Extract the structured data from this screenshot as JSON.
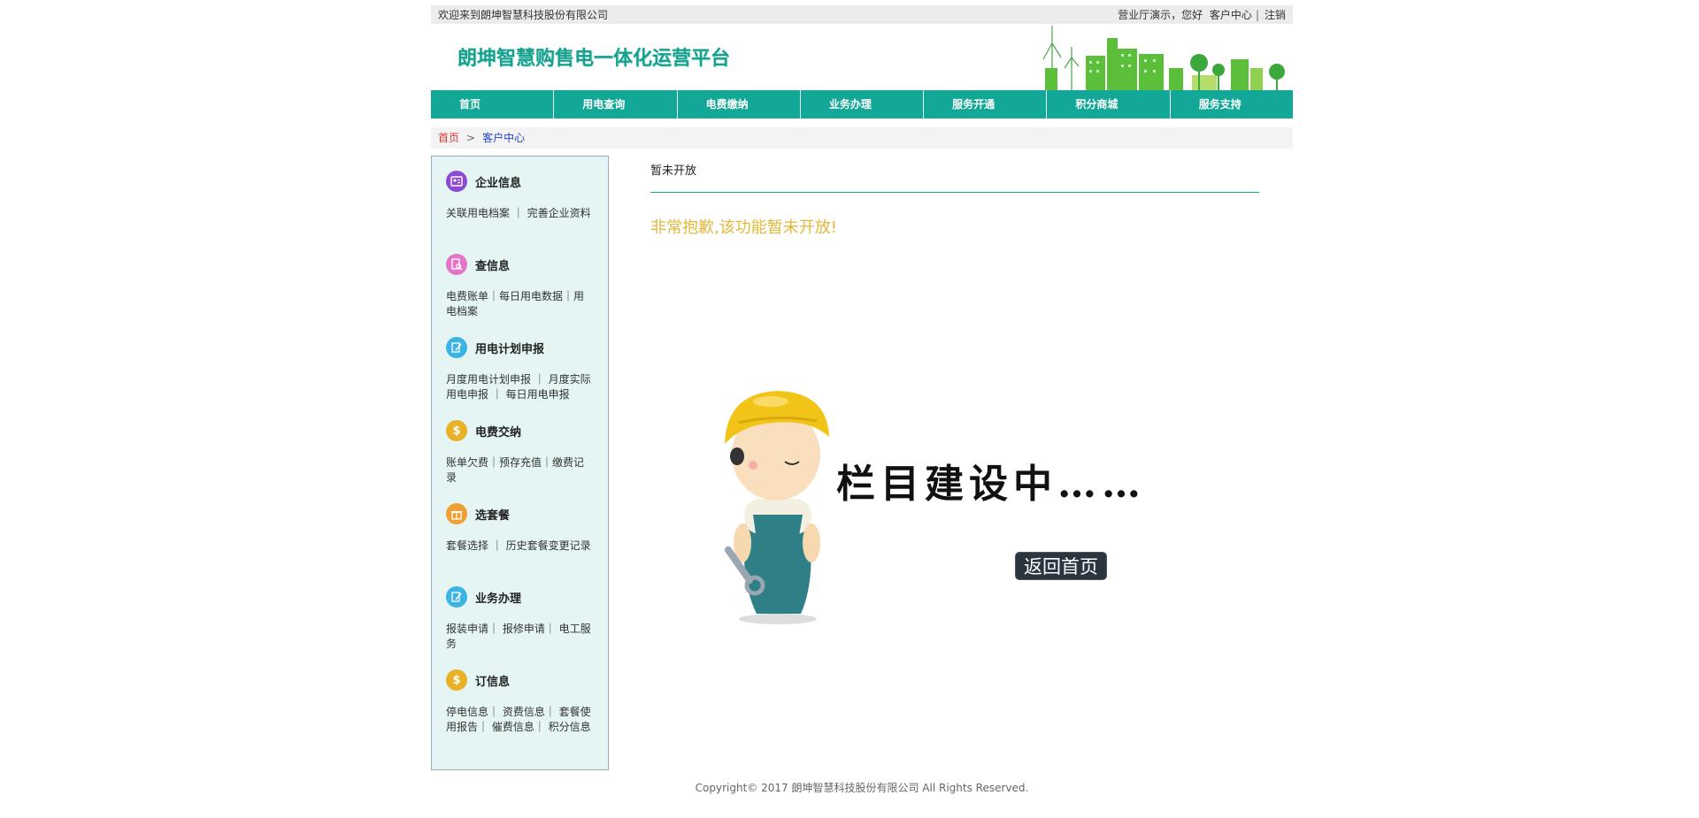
{
  "topbar": {
    "welcome": "欢迎来到朗坤智慧科技股份有限公司",
    "user_greeting": "营业厅演示，您好",
    "customer_center": "客户中心",
    "separator": "|",
    "logout": "注销"
  },
  "header": {
    "logo_text": "朗坤智慧购售电一体化运营平台"
  },
  "nav": {
    "items": [
      {
        "label": "首页"
      },
      {
        "label": "用电查询"
      },
      {
        "label": "电费缴纳"
      },
      {
        "label": "业务办理"
      },
      {
        "label": "服务开通"
      },
      {
        "label": "积分商城"
      },
      {
        "label": "服务支持"
      }
    ]
  },
  "breadcrumb": {
    "home": "首页",
    "separator": ">",
    "current": "客户中心"
  },
  "sidebar": {
    "sections": [
      {
        "title": "企业信息",
        "icon": "user-card-icon",
        "color": "#8e49d6",
        "links": "关联用电档案 ｜ 完善企业资料"
      },
      {
        "title": "查信息",
        "icon": "document-search-icon",
        "color": "#e275c6",
        "links": "电费账单｜每日用电数据｜用电档案"
      },
      {
        "title": "用电计划申报",
        "icon": "edit-document-icon",
        "color": "#3bb3e3",
        "links": "月度用电计划申报 ｜ 月度实际用电申报 ｜ 每日用电申报"
      },
      {
        "title": "电费交纳",
        "icon": "dollar-icon",
        "color": "#e8b128",
        "links": "账单欠费｜预存充值｜缴费记录"
      },
      {
        "title": "选套餐",
        "icon": "gift-icon",
        "color": "#f0a033",
        "links": "套餐选择 ｜ 历史套餐变更记录"
      },
      {
        "title": "业务办理",
        "icon": "edit-document-icon",
        "color": "#3bb3e3",
        "links": "报装申请｜ 报修申请｜ 电工服务"
      },
      {
        "title": "订信息",
        "icon": "dollar-icon",
        "color": "#e8b128",
        "links": "停电信息｜ 资费信息｜ 套餐使用报告｜ 催费信息｜ 积分信息"
      }
    ]
  },
  "main": {
    "title": "暂未开放",
    "sorry_message": "非常抱歉,该功能暂未开放!",
    "building_text": "栏目建设中……",
    "back_button": "返回首页"
  },
  "footer": {
    "copyright": "Copyright© 2017 朗坤智慧科技股份有限公司 All Rights Reserved."
  },
  "colors": {
    "brand": "#12a796",
    "warning": "#e4b83c",
    "sidebar_bg": "#e4f5f4"
  }
}
